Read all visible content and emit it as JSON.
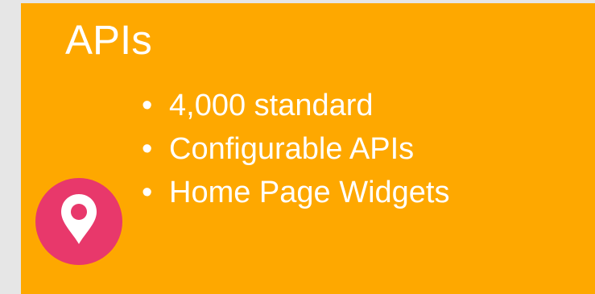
{
  "slide": {
    "title": "APIs",
    "bullet_symbol": "•",
    "bullets": [
      "4,000 standard",
      "Configurable APIs",
      "Home Page Widgets"
    ]
  },
  "colors": {
    "background": "#e6e6e6",
    "card": "#fea800",
    "text": "#ffffff",
    "pin_badge": "#e8386b"
  },
  "icons": {
    "badge": "location-pin-icon"
  }
}
